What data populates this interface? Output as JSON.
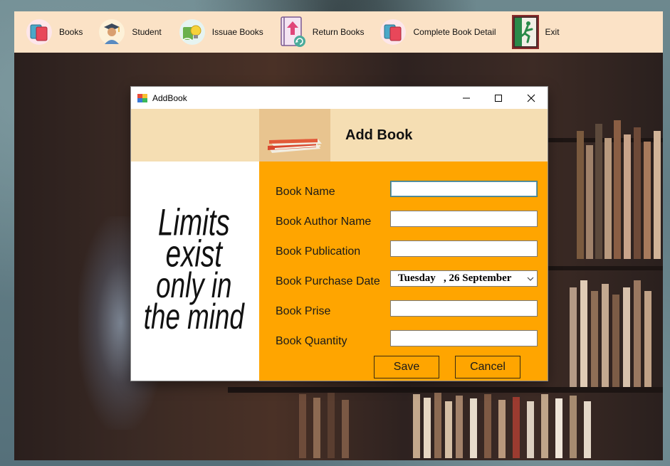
{
  "menu": {
    "items": [
      {
        "label": "Books",
        "icon": "books-icon"
      },
      {
        "label": "Student",
        "icon": "student-graduate-icon"
      },
      {
        "label": "Issuae Books",
        "icon": "issue-book-bulb-icon"
      },
      {
        "label": "Return Books",
        "icon": "return-book-icon"
      },
      {
        "label": "Complete Book Detail",
        "icon": "book-detail-icon"
      },
      {
        "label": "Exit",
        "icon": "exit-running-man-icon"
      }
    ]
  },
  "dialog": {
    "title": "AddBook",
    "header_title": "Add Book",
    "quote": [
      "Limits",
      "exist",
      "only in",
      "the mind"
    ],
    "fields": [
      {
        "label": "Book Name",
        "value": ""
      },
      {
        "label": "Book Author Name",
        "value": ""
      },
      {
        "label": "Book Publication",
        "value": ""
      },
      {
        "label": "Book Purchase Date",
        "value": "Tuesday   , 26 September"
      },
      {
        "label": "Book Prise",
        "value": ""
      },
      {
        "label": "Book Quantity",
        "value": ""
      }
    ],
    "save_label": "Save",
    "cancel_label": "Cancel"
  },
  "colors": {
    "menubar": "#fbe2c6",
    "header": "#f5deb3",
    "form": "#ffa500"
  }
}
